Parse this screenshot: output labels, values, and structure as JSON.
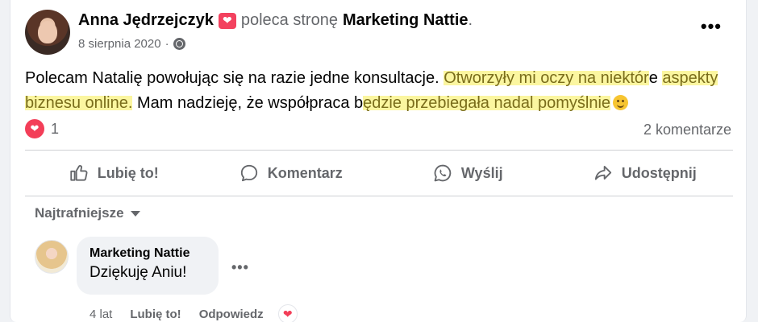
{
  "post": {
    "author": "Anna Jędrzejczyk",
    "verb": "poleca stronę",
    "page": "Marketing Nattie",
    "period": ".",
    "date": "8 sierpnia 2020",
    "separator": "·",
    "more_label": "•••",
    "text_parts": {
      "p1": "Polecam Natalię powołując się na razie jedne konsultacje. ",
      "h1": "Otworzyły mi oczy na niektór",
      "p2": "e ",
      "h2a": "a",
      "h2": "spekty biznesu online.",
      "p3": " Mam nadzieję, że współpraca b",
      "h3": "ędzie przebiegała nadal pomyślnie"
    },
    "reaction_count": "1",
    "comments_count": "2 komentarze"
  },
  "actions": {
    "like": "Lubię to!",
    "comment": "Komentarz",
    "send": "Wyślij",
    "share": "Udostępnij"
  },
  "sort_label": "Najtrafniejsze",
  "comment": {
    "author": "Marketing Nattie",
    "text": "Dziękuję Aniu!",
    "more_label": "•••",
    "age": "4 lat",
    "like": "Lubię to!",
    "reply": "Odpowiedz"
  },
  "colors": {
    "highlight": "#fbf6a0",
    "heart": "#f33e58",
    "muted": "#65676b"
  }
}
